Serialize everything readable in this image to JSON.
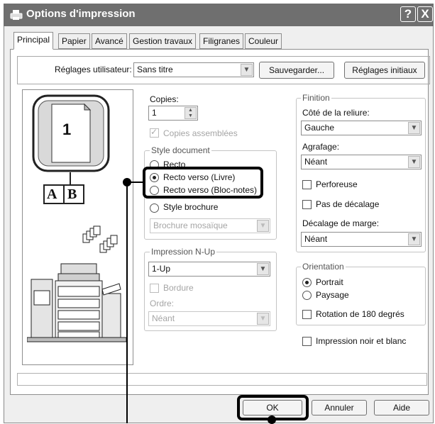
{
  "window": {
    "title": "Options d'impression",
    "help_label": "?",
    "close_label": "X"
  },
  "tabs": [
    {
      "label": "Principal",
      "active": true
    },
    {
      "label": "Papier",
      "active": false
    },
    {
      "label": "Avancé",
      "active": false
    },
    {
      "label": "Gestion travaux",
      "active": false
    },
    {
      "label": "Filigranes",
      "active": false
    },
    {
      "label": "Couleur",
      "active": false
    }
  ],
  "settings": {
    "label": "Réglages utilisateur:",
    "value": "Sans titre",
    "save_label": "Sauvegarder...",
    "defaults_label": "Réglages initiaux"
  },
  "preview": {
    "page_number": "1",
    "binding_letters": [
      "A",
      "B"
    ]
  },
  "copies": {
    "label": "Copies:",
    "value": "1",
    "collate_label": "Copies assemblées",
    "collate_checked": true,
    "collate_enabled": false
  },
  "document_style": {
    "title": "Style document",
    "options": [
      {
        "label": "Recto",
        "selected": false
      },
      {
        "label": "Recto verso (Livre)",
        "selected": true
      },
      {
        "label": "Recto verso (Bloc-notes)",
        "selected": false
      },
      {
        "label": "Style brochure",
        "selected": false
      }
    ],
    "booklet_select": "Brochure mosaïque"
  },
  "nup": {
    "title": "Impression N-Up",
    "value": "1-Up",
    "border_label": "Bordure",
    "order_label": "Ordre:",
    "order_value": "Néant"
  },
  "finishing": {
    "title": "Finition",
    "binding_label": "Côté de la reliure:",
    "binding_value": "Gauche",
    "staple_label": "Agrafage:",
    "staple_value": "Néant",
    "punch_label": "Perforeuse",
    "no_offset_label": "Pas de décalage",
    "margin_label": "Décalage de marge:",
    "margin_value": "Néant"
  },
  "orientation": {
    "title": "Orientation",
    "portrait_label": "Portrait",
    "landscape_label": "Paysage",
    "selected": "portrait",
    "rotate_label": "Rotation de 180 degrés"
  },
  "bw_label": "Impression noir et blanc",
  "footer": {
    "ok_label": "OK",
    "cancel_label": "Annuler",
    "help_label": "Aide"
  },
  "colors": {
    "titlebar": "#6f6f6f",
    "callout": "#000000"
  }
}
